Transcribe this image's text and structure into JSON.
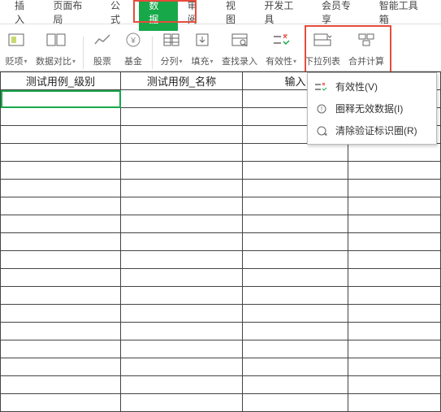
{
  "menubar": {
    "items": [
      "插入",
      "页面布局",
      "公式",
      "数据",
      "审阅",
      "视图",
      "开发工具",
      "会员专享",
      "智能工具箱"
    ],
    "active_index": 3
  },
  "toolbar": {
    "items": [
      {
        "label": "贬项",
        "has_caret": true
      },
      {
        "label": "数据对比",
        "has_caret": true
      },
      {
        "label": "股票",
        "has_caret": false
      },
      {
        "label": "基金",
        "has_caret": false
      },
      {
        "label": "分列",
        "has_caret": true
      },
      {
        "label": "填充",
        "has_caret": true
      },
      {
        "label": "查找录入",
        "has_caret": false
      },
      {
        "label": "有效性",
        "has_caret": true
      },
      {
        "label": "下拉列表",
        "has_caret": false
      },
      {
        "label": "合并计算",
        "has_caret": false
      }
    ]
  },
  "dropdown": {
    "items": [
      {
        "label": "有效性(V)"
      },
      {
        "label": "圈释无效数据(I)"
      },
      {
        "label": "清除验证标识圈(R)"
      }
    ]
  },
  "sheet": {
    "headers": [
      "测试用例_级别",
      "测试用例_名称",
      "输入"
    ]
  }
}
